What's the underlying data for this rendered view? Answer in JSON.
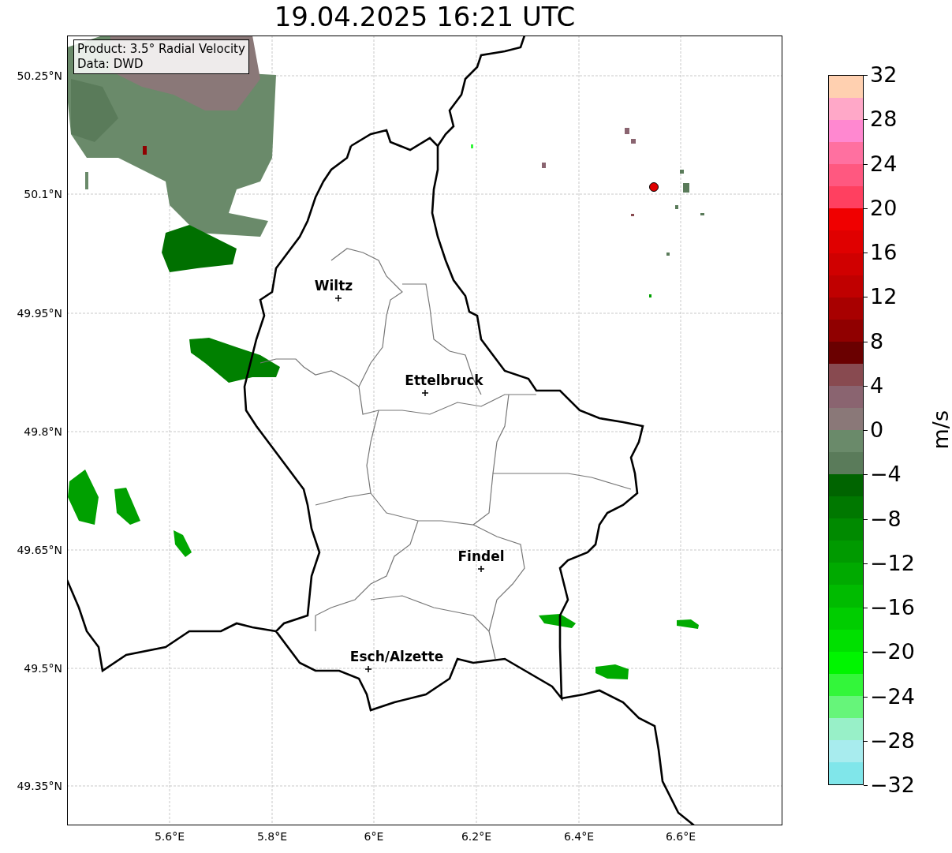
{
  "title": "19.04.2025 16:21 UTC",
  "info_box": {
    "lines": [
      "Product: 3.5° Radial Velocity",
      "Data: DWD"
    ]
  },
  "x_ticks": [
    "5.6°E",
    "5.8°E",
    "6°E",
    "6.2°E",
    "6.4°E",
    "6.6°E"
  ],
  "y_ticks": [
    "50.25°N",
    "50.1°N",
    "49.95°N",
    "49.8°N",
    "49.65°N",
    "49.5°N",
    "49.35°N"
  ],
  "cities": [
    {
      "name": "Wiltz"
    },
    {
      "name": "Ettelbruck"
    },
    {
      "name": "Findel"
    },
    {
      "name": "Esch/Alzette"
    }
  ],
  "colorbar": {
    "label": "m/s",
    "ticks": [
      "32",
      "28",
      "24",
      "20",
      "16",
      "12",
      "8",
      "4",
      "0",
      "−4",
      "−8",
      "−12",
      "−16",
      "−20",
      "−24",
      "−28",
      "−32"
    ],
    "bands": [
      {
        "color": "#ffd0b0"
      },
      {
        "color": "#ffa8c8"
      },
      {
        "color": "#ff88d0"
      },
      {
        "color": "#ff70a0"
      },
      {
        "color": "#ff5880"
      },
      {
        "color": "#ff4060"
      },
      {
        "color": "#f00000"
      },
      {
        "color": "#e00000"
      },
      {
        "color": "#d00000"
      },
      {
        "color": "#c00000"
      },
      {
        "color": "#a80000"
      },
      {
        "color": "#900000"
      },
      {
        "color": "#6a0000"
      },
      {
        "color": "#884a50"
      },
      {
        "color": "#8a6470"
      },
      {
        "color": "#8a7878"
      },
      {
        "color": "#6a8a6a"
      },
      {
        "color": "#5a7b5a"
      },
      {
        "color": "#006400"
      },
      {
        "color": "#007800"
      },
      {
        "color": "#008a00"
      },
      {
        "color": "#009a00"
      },
      {
        "color": "#00aa00"
      },
      {
        "color": "#00bb00"
      },
      {
        "color": "#00cd00"
      },
      {
        "color": "#00e000"
      },
      {
        "color": "#00f500"
      },
      {
        "color": "#33f63a"
      },
      {
        "color": "#66f57a"
      },
      {
        "color": "#98f0c8"
      },
      {
        "color": "#a8ecee"
      },
      {
        "color": "#80e6ea"
      }
    ]
  }
}
